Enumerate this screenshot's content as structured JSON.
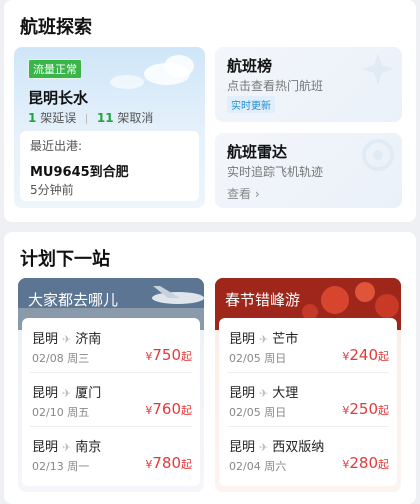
{
  "flight_explore": {
    "title": "航班探索",
    "status": {
      "flow_badge": "流量正常",
      "route": "昆明长水",
      "delayed_count": "1",
      "delayed_label": "架延误",
      "cancelled_count": "11",
      "cancelled_label": "架取消",
      "recent_label": "最近出港:",
      "recent_flight": "MU9645到合肥",
      "recent_time": "5分钟前"
    },
    "rank_tile": {
      "title": "航班榜",
      "subtitle": "点击查看热门航班",
      "badge": "实时更新"
    },
    "radar_tile": {
      "title": "航班雷达",
      "subtitle": "实时追踪飞机轨迹",
      "link": "查看 ›"
    }
  },
  "plan_next": {
    "title": "计划下一站",
    "columns": [
      {
        "title": "大家都去哪儿",
        "routes": [
          {
            "from": "昆明",
            "to": "济南",
            "date": "02/08 周三",
            "currency": "¥",
            "price": "750",
            "suffix": "起"
          },
          {
            "from": "昆明",
            "to": "厦门",
            "date": "02/10 周五",
            "currency": "¥",
            "price": "760",
            "suffix": "起"
          },
          {
            "from": "昆明",
            "to": "南京",
            "date": "02/13 周一",
            "currency": "¥",
            "price": "780",
            "suffix": "起"
          }
        ]
      },
      {
        "title": "春节错峰游",
        "routes": [
          {
            "from": "昆明",
            "to": "芒市",
            "date": "02/05 周日",
            "currency": "¥",
            "price": "240",
            "suffix": "起"
          },
          {
            "from": "昆明",
            "to": "大理",
            "date": "02/05 周日",
            "currency": "¥",
            "price": "250",
            "suffix": "起"
          },
          {
            "from": "昆明",
            "to": "西双版纳",
            "date": "02/04 周六",
            "currency": "¥",
            "price": "280",
            "suffix": "起"
          }
        ]
      }
    ]
  },
  "colors": {
    "accent_green": "#20a53a",
    "price_red": "#e4393c",
    "badge_blue": "#1f8ad8"
  }
}
